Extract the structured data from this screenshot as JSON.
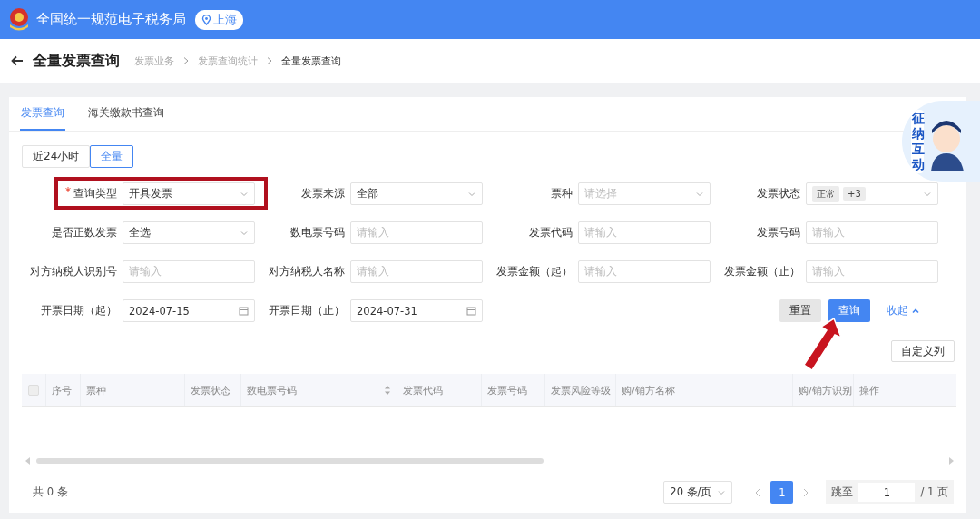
{
  "header": {
    "title": "全国统一规范电子税务局",
    "location": "上海"
  },
  "page": {
    "title": "全量发票查询",
    "breadcrumb": [
      "发票业务",
      "发票查询统计",
      "全量发票查询"
    ]
  },
  "tabs": [
    {
      "label": "发票查询",
      "selected": true
    },
    {
      "label": "海关缴款书查询",
      "selected": false
    }
  ],
  "range_toggle": [
    {
      "label": "近24小时",
      "selected": false
    },
    {
      "label": "全量",
      "selected": true
    }
  ],
  "filters": [
    {
      "label": "查询类型",
      "required": true,
      "kind": "select",
      "value": "开具发票"
    },
    {
      "label": "发票来源",
      "required": false,
      "kind": "select",
      "value": "全部"
    },
    {
      "label": "票种",
      "required": false,
      "kind": "select",
      "placeholder": "请选择"
    },
    {
      "label": "发票状态",
      "required": false,
      "kind": "tags",
      "tags": [
        "正常",
        "+3"
      ]
    },
    {
      "label": "是否正数发票",
      "required": false,
      "kind": "select",
      "value": "全选"
    },
    {
      "label": "数电票号码",
      "required": false,
      "kind": "input",
      "placeholder": "请输入"
    },
    {
      "label": "发票代码",
      "required": false,
      "kind": "input",
      "placeholder": "请输入"
    },
    {
      "label": "发票号码",
      "required": false,
      "kind": "input",
      "placeholder": "请输入"
    },
    {
      "label": "对方纳税人识别号",
      "required": false,
      "kind": "input",
      "placeholder": "请输入"
    },
    {
      "label": "对方纳税人名称",
      "required": false,
      "kind": "input",
      "placeholder": "请输入"
    },
    {
      "label": "发票金额（起）",
      "required": false,
      "kind": "input",
      "placeholder": "请输入"
    },
    {
      "label": "发票金额（止）",
      "required": false,
      "kind": "input",
      "placeholder": "请输入"
    },
    {
      "label": "开票日期（起）",
      "required": false,
      "kind": "date",
      "value": "2024-07-15"
    },
    {
      "label": "开票日期（止）",
      "required": false,
      "kind": "date",
      "value": "2024-07-31"
    }
  ],
  "actions": {
    "reset": "重置",
    "search": "查询",
    "collapse": "收起"
  },
  "customize_button": "自定义列",
  "table": {
    "select_all_checked": false,
    "columns": [
      {
        "label": "序号",
        "sortable": false
      },
      {
        "label": "票种",
        "sortable": false
      },
      {
        "label": "发票状态",
        "sortable": false
      },
      {
        "label": "数电票号码",
        "sortable": true
      },
      {
        "label": "发票代码",
        "sortable": false
      },
      {
        "label": "发票号码",
        "sortable": false
      },
      {
        "label": "发票风险等级",
        "sortable": false
      },
      {
        "label": "购/销方名称",
        "sortable": false
      },
      {
        "label": "购/销方识别",
        "sortable": false
      },
      {
        "label": "操作",
        "sortable": false
      }
    ]
  },
  "footer": {
    "total": "共 0 条",
    "page_size": "20 条/页",
    "pages": [
      {
        "label": "1",
        "selected": true
      }
    ],
    "jump_label": "跳至",
    "jump_value": "1",
    "page_total": "/ 1 页"
  },
  "mascot": {
    "text": "征纳互动"
  },
  "annotations": {
    "frame_on_first_filter": true,
    "arrow_to_search": true
  }
}
